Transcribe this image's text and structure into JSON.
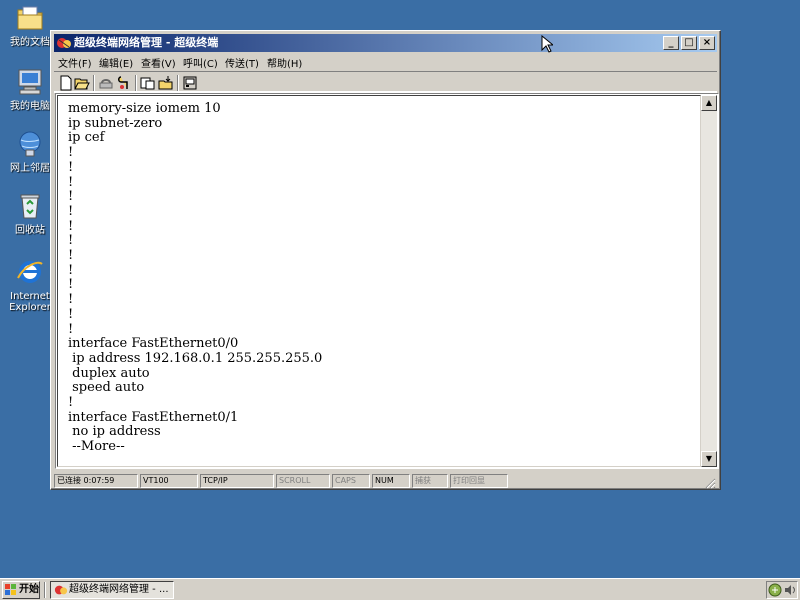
{
  "desktop": {
    "icons": [
      {
        "label": "我的文档",
        "icon": "my-documents-icon"
      },
      {
        "label": "我的电脑",
        "icon": "my-computer-icon"
      },
      {
        "label": "网上邻居",
        "icon": "network-places-icon"
      },
      {
        "label": "回收站",
        "icon": "recycle-bin-icon"
      },
      {
        "label": "Internet Explorer",
        "icon": "internet-explorer-icon"
      }
    ]
  },
  "window": {
    "title": "超级终端网络管理 - 超级终端",
    "controls": {
      "minimize": "_",
      "maximize": "□",
      "close": "×"
    },
    "menu": [
      "文件(F)",
      "编辑(E)",
      "查看(V)",
      "呼叫(C)",
      "传送(T)",
      "帮助(H)"
    ],
    "toolbar": [
      "new-icon",
      "open-icon",
      "disconnect-icon",
      "properties-icon",
      "send-icon",
      "receive-icon",
      "settings-icon"
    ]
  },
  "terminal": {
    "text": "memory-size iomem 10\nip subnet-zero\nip cef\n!\n!\n!\n!\n!\n!\n!\n!\n!\n!\n!\n!\n!\ninterface FastEthernet0/0\n ip address 192.168.0.1 255.255.255.0\n duplex auto\n speed auto\n!\ninterface FastEthernet0/1\n no ip address\n --More--"
  },
  "statusbar": {
    "connected": "已连接 0:07:59",
    "emulation": "VT100",
    "protocol": "TCP/IP",
    "scroll": "SCROLL",
    "caps": "CAPS",
    "num": "NUM",
    "capture": "捕获",
    "print_echo": "打印回显"
  },
  "taskbar": {
    "start": "开始",
    "task": "超级终端网络管理 - ..."
  },
  "colors": {
    "desktop": "#3a6ea5",
    "titlebar_start": "#0a246a",
    "titlebar_end": "#a6caf0",
    "chrome": "#d4d0c8"
  }
}
